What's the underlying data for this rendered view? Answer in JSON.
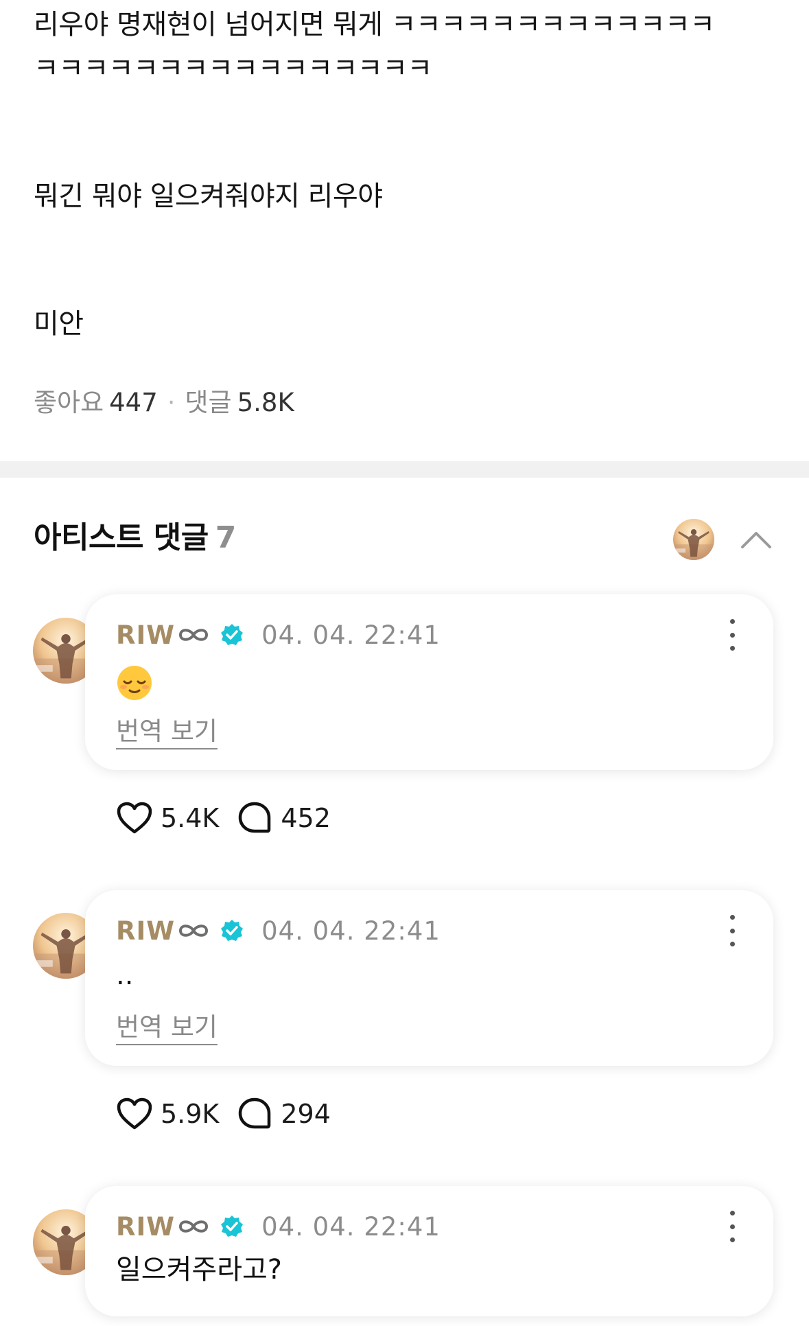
{
  "post": {
    "lines": [
      "리우야 명재현이 넘어지면 뭐게 ㅋㅋㅋㅋㅋㅋㅋㅋㅋㅋㅋㅋㅋ",
      "ㅋㅋㅋㅋㅋㅋㅋㅋㅋㅋㅋㅋㅋㅋㅋㅋ",
      "뭐긴 뭐야 일으켜줘야지 리우야",
      "미안"
    ],
    "likes_label": "좋아요",
    "likes_count": "447",
    "separator": "·",
    "comments_label": "댓글",
    "comments_count": "5.8K"
  },
  "artist_comments": {
    "title": "아티스트 댓글",
    "count": "7",
    "collapse_icon": "chevron-up-icon",
    "items": [
      {
        "author": "RIW",
        "date": "04. 04. 22:41",
        "text": "",
        "emoji": "relieved-face-emoji",
        "translate": "번역 보기",
        "likes": "5.4K",
        "replies": "452"
      },
      {
        "author": "RIW",
        "date": "04. 04. 22:41",
        "text": "..",
        "translate": "번역 보기",
        "likes": "5.9K",
        "replies": "294"
      },
      {
        "author": "RIW",
        "date": "04. 04. 22:41",
        "text": "일으켜주라고?"
      }
    ]
  },
  "colors": {
    "author": "#a58c64",
    "verified": "#19c4d6",
    "muted": "#8a8a8a",
    "divider": "#f1f1f1"
  }
}
